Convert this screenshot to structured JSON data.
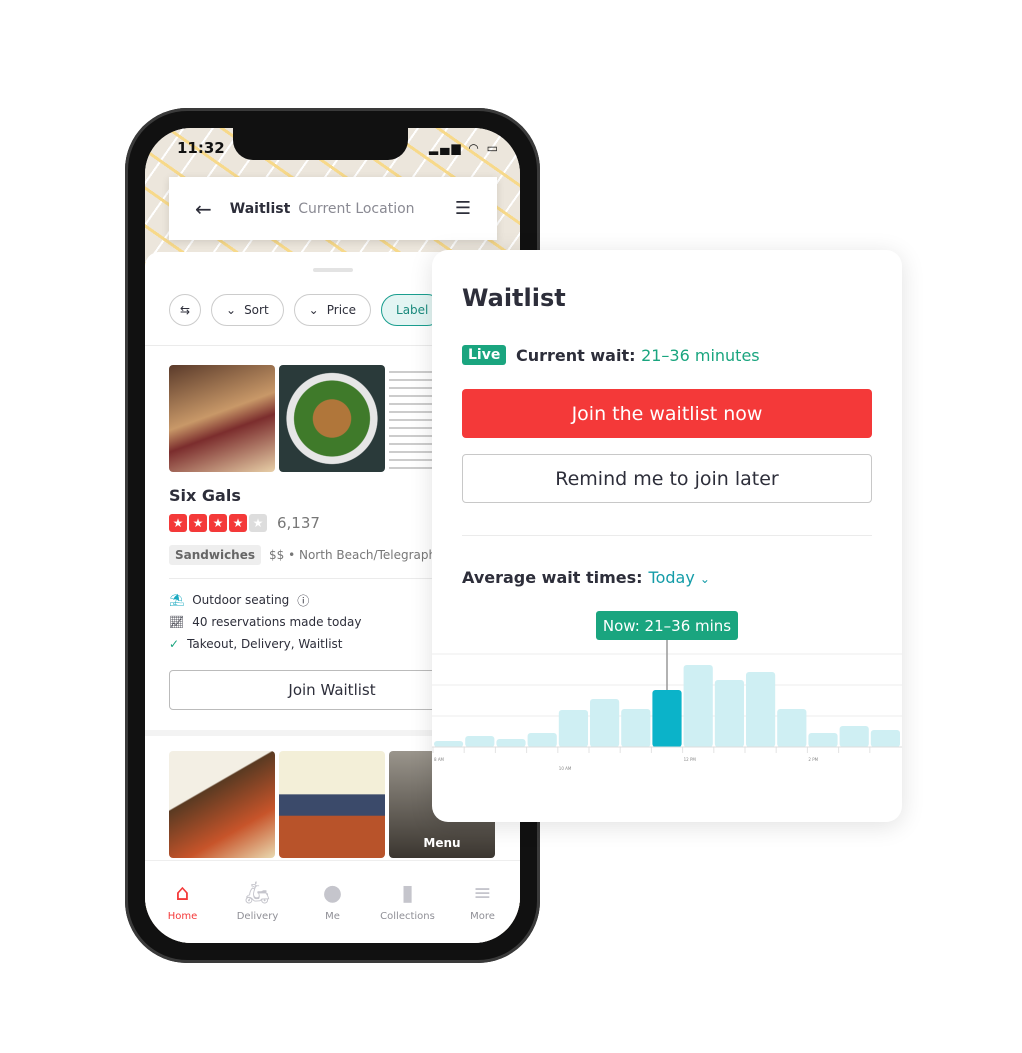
{
  "status_bar": {
    "time": "11:32",
    "icons": "signal wifi battery"
  },
  "top_bar": {
    "title": "Waitlist",
    "location": "Current Location",
    "back_icon": "arrow-left",
    "list_icon": "list"
  },
  "filters": [
    {
      "label": ""
    },
    {
      "label": "Sort"
    },
    {
      "label": "Price"
    },
    {
      "label": "Label",
      "active": true
    }
  ],
  "business": {
    "name": "Six Gals",
    "rating": 4,
    "max_rating": 5,
    "review_count": "6,137",
    "category": "Sandwiches",
    "meta": "$$ • North Beach/Telegraph Hill",
    "features": [
      "Outdoor seating",
      "40 reservations made today",
      "Takeout, Delivery, Waitlist"
    ],
    "join_button": "Join Waitlist",
    "menu_label": "Menu"
  },
  "bottom_nav": [
    {
      "label": "Home",
      "icon": "home",
      "active": true
    },
    {
      "label": "Delivery",
      "icon": "scooter"
    },
    {
      "label": "Me",
      "icon": "user"
    },
    {
      "label": "Collections",
      "icon": "bookmark"
    },
    {
      "label": "More",
      "icon": "menu"
    }
  ],
  "waitlist_card": {
    "title": "Waitlist",
    "live_badge": "Live",
    "current_wait_label": "Current wait:",
    "current_wait_value": "21–36 minutes",
    "join_now": "Join the waitlist now",
    "remind_later": "Remind me to join later",
    "avg_label": "Average wait times:",
    "avg_period": "Today"
  },
  "colors": {
    "accent_red": "#f43939",
    "live_green": "#1aa57f",
    "bar_highlight": "#0bb3c9",
    "bar": "#cfeff3"
  },
  "chart_data": {
    "type": "bar",
    "tooltip": "Now: 21–36 mins",
    "highlight_index": 7,
    "values": [
      6,
      11,
      8,
      14,
      37,
      48,
      38,
      57,
      82,
      67,
      75,
      38,
      14,
      21,
      17
    ],
    "tick_labels": [
      {
        "index": 0,
        "label": "8 AM"
      },
      {
        "index": 4,
        "label": "10 AM"
      },
      {
        "index": 8,
        "label": "12 PM"
      },
      {
        "index": 12,
        "label": "2 PM"
      }
    ],
    "grid": true
  }
}
